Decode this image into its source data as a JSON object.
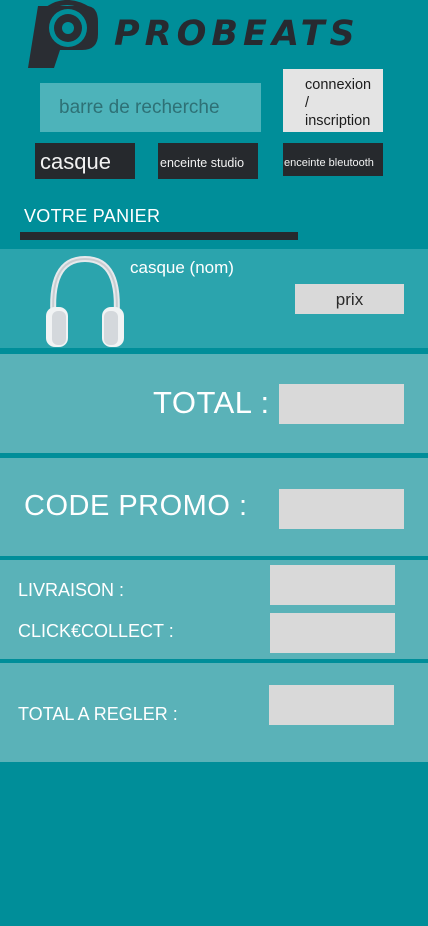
{
  "header": {
    "brand": "PROBEATS",
    "logo_icon": "probeats-logo-icon"
  },
  "search": {
    "placeholder": "barre de recherche"
  },
  "account": {
    "login_label_lines": [
      "connexion",
      "/",
      "inscription"
    ]
  },
  "categories": [
    {
      "label": "casque"
    },
    {
      "label": "enceinte studio"
    },
    {
      "label": "enceinte bleutooth"
    }
  ],
  "cart": {
    "title": "VOTRE PANIER",
    "item": {
      "icon": "headphones-icon",
      "name": "casque (nom)",
      "price_label": "prix"
    },
    "total_label": "TOTAL :",
    "promo_label": "CODE PROMO :",
    "delivery_label": "LIVRAISON :",
    "click_collect_label": "CLICK€COLLECT :",
    "pay_label": "TOTAL A REGLER :"
  },
  "colors": {
    "background": "#008e99",
    "dark": "#26292d",
    "section": "#5ab2b8",
    "item_section": "#2ba4ad",
    "input_grey": "#d9d9d9"
  }
}
